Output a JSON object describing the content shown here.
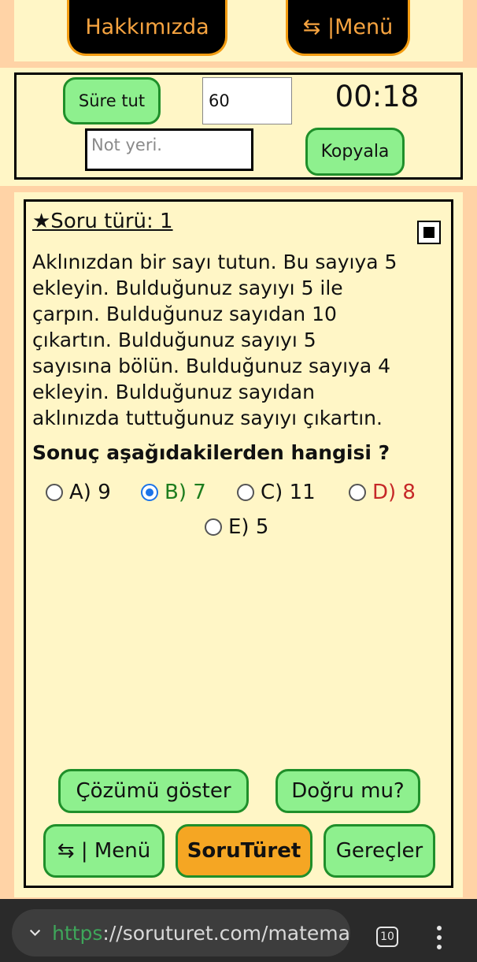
{
  "header": {
    "about_label": "Hakkımızda",
    "menu_label": "⇆ |Menü"
  },
  "timer": {
    "start_label": "Süre tut",
    "seconds_value": "60",
    "clock_text": "00:18",
    "note_placeholder": "Not yeri.",
    "copy_label": "Kopyala"
  },
  "question": {
    "type_label": "★Soru türü:  1",
    "text_lines": [
      "Aklınızdan bir sayı tutun. Bu sayıya 5",
      "ekleyin. Bulduğunuz sayıyı 5 ile",
      "çarpın. Bulduğunuz sayıdan 10",
      "çıkartın. Bulduğunuz sayıyı 5",
      "sayısına bölün. Bulduğunuz sayıya 4",
      "ekleyin. Bulduğunuz sayıdan",
      "aklınızda tuttuğunuz sayıyı çıkartın."
    ],
    "prompt": "Sonuç aşağıdakilerden hangisi ?",
    "options": [
      {
        "label": "A) 9",
        "selected": false,
        "color": "#111111"
      },
      {
        "label": "B) 7",
        "selected": true,
        "color": "#1e7d1e"
      },
      {
        "label": "C) 11",
        "selected": false,
        "color": "#111111"
      },
      {
        "label": "D) 8",
        "selected": false,
        "color": "#c62828"
      },
      {
        "label": "E) 5",
        "selected": false,
        "color": "#111111"
      }
    ]
  },
  "actions": {
    "show_solution": "Çözümü göster",
    "check": "Doğru mu?",
    "menu": "⇆ | Menü",
    "generate": "SoruTüret",
    "tools": "Gereçler"
  },
  "browser": {
    "url_scheme": "https",
    "url_rest": "://soruturet.com/matema",
    "tab_count": "10"
  },
  "colors": {
    "page_bg": "#fff6c6",
    "band_bg": "#ffd3a6",
    "green_button": "#8ef08e",
    "green_border": "#1f8f2a",
    "orange_button": "#f5a623",
    "dark_button_text": "#f7a440"
  }
}
